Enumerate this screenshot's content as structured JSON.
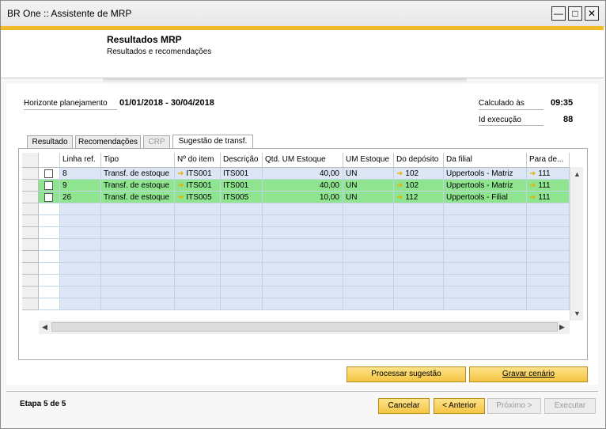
{
  "window": {
    "title": "BR One :: Assistente de MRP"
  },
  "header": {
    "title": "Resultados MRP",
    "subtitle": "Resultados e recomendações"
  },
  "info": {
    "horizon_label": "Horizonte planejamento",
    "horizon_value": "01/01/2018 - 30/04/2018",
    "calc_label": "Calculado às",
    "calc_value": "09:35",
    "exec_label": "Id execução",
    "exec_value": "88"
  },
  "tabs": [
    {
      "label": "Resultado"
    },
    {
      "label": "Recomendações"
    },
    {
      "label": "CRP"
    },
    {
      "label": "Sugestão de transf."
    }
  ],
  "grid": {
    "columns": [
      "Linha ref.",
      "Tipo",
      "Nº do item",
      "Descrição",
      "Qtd. UM Estoque",
      "UM Estoque",
      "Do depósito",
      "Da filial",
      "Para de..."
    ],
    "rows": [
      {
        "ref": "8",
        "tipo": "Transf. de estoque",
        "item": "ITS001",
        "desc": "ITS001",
        "qtd": "40,00",
        "um": "UN",
        "do_dep": "102",
        "da_filial": "Uppertools - Matriz",
        "para_dep": "111"
      },
      {
        "ref": "9",
        "tipo": "Transf. de estoque",
        "item": "ITS001",
        "desc": "ITS001",
        "qtd": "40,00",
        "um": "UN",
        "do_dep": "102",
        "da_filial": "Uppertools - Matriz",
        "para_dep": "111"
      },
      {
        "ref": "26",
        "tipo": "Transf. de estoque",
        "item": "ITS005",
        "desc": "ITS005",
        "qtd": "10,00",
        "um": "UN",
        "do_dep": "112",
        "da_filial": "Uppertools - Filial",
        "para_dep": "111"
      }
    ]
  },
  "actions": {
    "process": "Processar sugestão",
    "save_scenario": "Gravar cenário"
  },
  "footer": {
    "step": "Etapa 5 de 5",
    "cancel": "Cancelar",
    "previous": "< Anterior",
    "next": "Próximo >",
    "execute": "Executar"
  },
  "colors": {
    "accent": "#f3ba27",
    "row_selected": "#dce6f4",
    "row_highlight": "#8fe58f",
    "empty_row": "#dce6f4"
  }
}
